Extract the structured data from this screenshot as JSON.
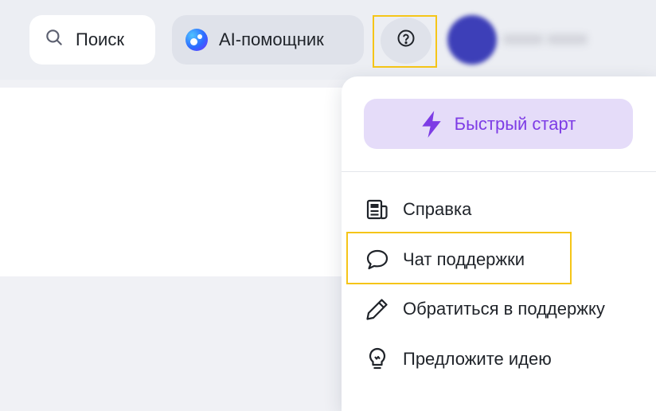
{
  "topbar": {
    "search": {
      "label": "Поиск",
      "icon": "search-icon"
    },
    "ai_assistant": {
      "label": "AI-помощник",
      "icon": "ai-assistant-logo"
    },
    "help": {
      "icon": "help-circle-icon"
    },
    "user": {
      "name": "xxxxx xxxxx"
    }
  },
  "help_menu": {
    "quick_start": {
      "label": "Быстрый старт",
      "icon": "lightning-icon"
    },
    "items": [
      {
        "label": "Справка",
        "icon": "docs-icon"
      },
      {
        "label": "Чат поддержки",
        "icon": "chat-bubble-icon"
      },
      {
        "label": "Обратиться в поддержку",
        "icon": "pencil-icon"
      },
      {
        "label": "Предложите идею",
        "icon": "lightbulb-icon"
      }
    ]
  },
  "colors": {
    "highlight": "#f5c518",
    "quick_start_bg": "#e5dcf9",
    "quick_start_text": "#7d3ce5"
  }
}
